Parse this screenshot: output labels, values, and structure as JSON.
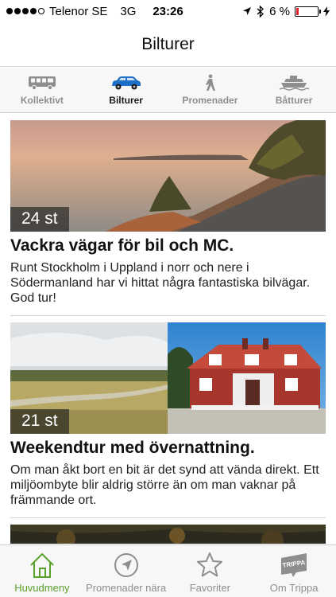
{
  "status_bar": {
    "carrier": "Telenor SE",
    "network": "3G",
    "time": "23:26",
    "battery_percent": "6 %",
    "battery_level": 0.06
  },
  "nav": {
    "title": "Bilturer"
  },
  "categories": [
    {
      "label": "Kollektivt",
      "icon": "bus-icon",
      "active": false
    },
    {
      "label": "Bilturer",
      "icon": "car-icon",
      "active": true
    },
    {
      "label": "Promenader",
      "icon": "walker-icon",
      "active": false
    },
    {
      "label": "Båtturer",
      "icon": "boat-icon",
      "active": false
    }
  ],
  "cards": [
    {
      "count": "24 st",
      "title": "Vackra vägar för bil och MC.",
      "description": "Runt Stockholm i Uppland i norr och nere i Södermanland har vi hittat några fantastiska bilvägar. God tur!"
    },
    {
      "count": "21 st",
      "title": "Weekendtur med övernattning.",
      "description": "Om man åkt bort en bit är det synd att vända direkt. Ett miljöombyte blir aldrig större än om man vaknar på främmande ort."
    }
  ],
  "tab_bar": [
    {
      "label": "Huvudmeny",
      "icon": "home-icon",
      "active": true
    },
    {
      "label": "Promenader nära",
      "icon": "compass-icon",
      "active": false
    },
    {
      "label": "Favoriter",
      "icon": "star-icon",
      "active": false
    },
    {
      "label": "Om Trippa",
      "icon": "trippa-logo-icon",
      "active": false
    }
  ],
  "colors": {
    "accent_green": "#5aa02c",
    "active_blue": "#1e6fc7",
    "battery_red": "#e0202a"
  }
}
